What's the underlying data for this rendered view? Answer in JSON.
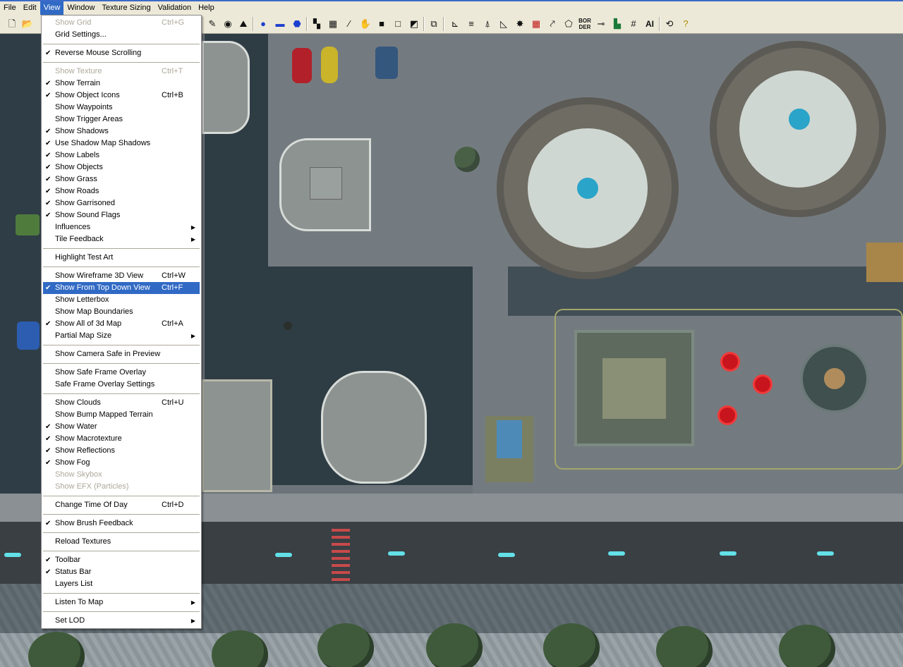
{
  "menubar": {
    "items": [
      "File",
      "Edit",
      "View",
      "Window",
      "Texture Sizing",
      "Validation",
      "Help"
    ],
    "active": "View"
  },
  "toolbar": {
    "border_label": "BOR\nDER",
    "ai_label": "AI"
  },
  "view_menu": {
    "items": [
      {
        "label": "Show Grid",
        "shortcut": "Ctrl+G",
        "checked": false,
        "disabled": true
      },
      {
        "label": "Grid Settings...",
        "checked": false
      },
      {
        "sep": true
      },
      {
        "label": "Reverse Mouse Scrolling",
        "checked": true
      },
      {
        "sep": true
      },
      {
        "label": "Show Texture",
        "shortcut": "Ctrl+T",
        "checked": false,
        "disabled": true
      },
      {
        "label": "Show Terrain",
        "checked": true
      },
      {
        "label": "Show Object Icons",
        "shortcut": "Ctrl+B",
        "checked": true
      },
      {
        "label": "Show Waypoints",
        "checked": false
      },
      {
        "label": "Show Trigger Areas",
        "checked": false
      },
      {
        "label": "Show Shadows",
        "checked": true
      },
      {
        "label": "Use Shadow Map Shadows",
        "checked": true
      },
      {
        "label": "Show Labels",
        "checked": true
      },
      {
        "label": "Show Objects",
        "checked": true
      },
      {
        "label": "Show Grass",
        "checked": true
      },
      {
        "label": "Show Roads",
        "checked": true
      },
      {
        "label": "Show Garrisoned",
        "checked": true
      },
      {
        "label": "Show Sound Flags",
        "checked": true
      },
      {
        "label": "Influences",
        "checked": false,
        "submenu": true
      },
      {
        "label": "Tile Feedback",
        "checked": false,
        "submenu": true
      },
      {
        "sep": true
      },
      {
        "label": "Highlight Test Art",
        "checked": false
      },
      {
        "sep": true
      },
      {
        "label": "Show Wireframe 3D View",
        "shortcut": "Ctrl+W",
        "checked": false
      },
      {
        "label": "Show From Top Down View",
        "shortcut": "Ctrl+F",
        "checked": true,
        "highlighted": true
      },
      {
        "label": "Show Letterbox",
        "checked": false
      },
      {
        "label": "Show Map Boundaries",
        "checked": false
      },
      {
        "label": "Show All of 3d Map",
        "shortcut": "Ctrl+A",
        "checked": true
      },
      {
        "label": "Partial Map Size",
        "checked": false,
        "submenu": true
      },
      {
        "sep": true
      },
      {
        "label": "Show Camera Safe in Preview",
        "checked": false
      },
      {
        "sep": true
      },
      {
        "label": "Show Safe Frame Overlay",
        "checked": false
      },
      {
        "label": "Safe Frame Overlay Settings",
        "checked": false
      },
      {
        "sep": true
      },
      {
        "label": "Show Clouds",
        "shortcut": "Ctrl+U",
        "checked": false
      },
      {
        "label": "Show Bump Mapped Terrain",
        "checked": false
      },
      {
        "label": "Show Water",
        "checked": true
      },
      {
        "label": "Show Macrotexture",
        "checked": true
      },
      {
        "label": "Show Reflections",
        "checked": true
      },
      {
        "label": "Show Fog",
        "checked": true
      },
      {
        "label": "Show Skybox",
        "checked": false,
        "disabled": true
      },
      {
        "label": "Show EFX (Particles)",
        "checked": false,
        "disabled": true
      },
      {
        "sep": true
      },
      {
        "label": "Change Time Of Day",
        "shortcut": "Ctrl+D",
        "checked": false
      },
      {
        "sep": true
      },
      {
        "label": "Show Brush Feedback",
        "checked": true
      },
      {
        "sep": true
      },
      {
        "label": "Reload Textures",
        "checked": false
      },
      {
        "sep": true
      },
      {
        "label": "Toolbar",
        "checked": true
      },
      {
        "label": "Status Bar",
        "checked": true
      },
      {
        "label": "Layers List",
        "checked": false
      },
      {
        "sep": true
      },
      {
        "label": "Listen To Map",
        "checked": false,
        "submenu": true
      },
      {
        "sep": true
      },
      {
        "label": "Set LOD",
        "checked": false,
        "submenu": true
      }
    ]
  },
  "colors": {
    "menu_highlight": "#316ac5",
    "menu_bg": "#ece9d8",
    "disabled_text": "#aca899"
  }
}
